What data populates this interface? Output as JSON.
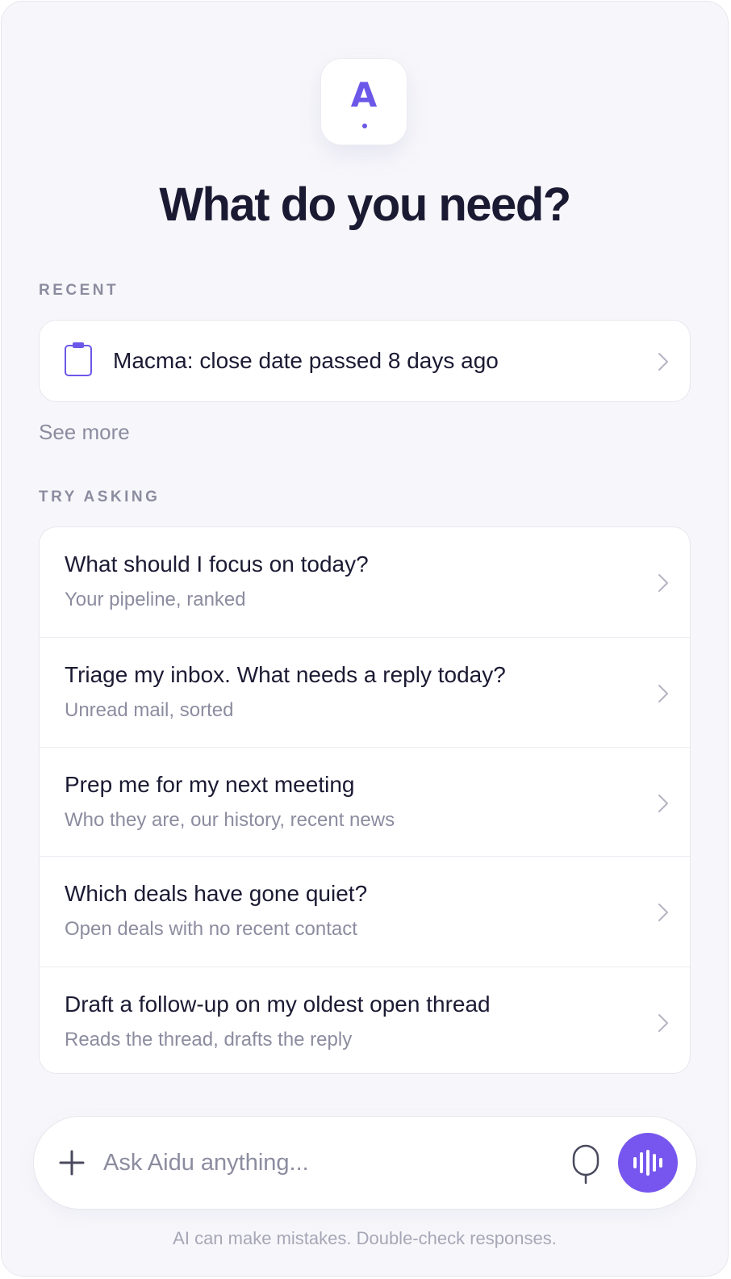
{
  "app": {
    "logo_letter": "A",
    "accent_color": "#6b57e8",
    "voice_button_color": "#7656ee"
  },
  "header": {
    "title": "What do you need?"
  },
  "recent": {
    "label": "RECENT",
    "item": {
      "icon": "clipboard-icon",
      "text": "Macma: close date passed 8 days ago"
    },
    "see_more": "See more"
  },
  "try_asking": {
    "label": "TRY ASKING",
    "items": [
      {
        "title": "What should I focus on today?",
        "subtitle": "Your pipeline, ranked"
      },
      {
        "title": "Triage my inbox. What needs a reply today?",
        "subtitle": "Unread mail, sorted"
      },
      {
        "title": "Prep me for my next meeting",
        "subtitle": "Who they are, our history, recent news"
      },
      {
        "title": "Which deals have gone quiet?",
        "subtitle": "Open deals with no recent contact"
      },
      {
        "title": "Draft a follow-up on my oldest open thread",
        "subtitle": "Reads the thread, drafts the reply"
      }
    ]
  },
  "composer": {
    "placeholder": "Ask Aidu anything...",
    "value": "",
    "icons": [
      "plus-icon",
      "microphone-icon",
      "voice-waveform-icon"
    ]
  },
  "footer": {
    "disclaimer": "AI can make mistakes. Double-check responses."
  }
}
